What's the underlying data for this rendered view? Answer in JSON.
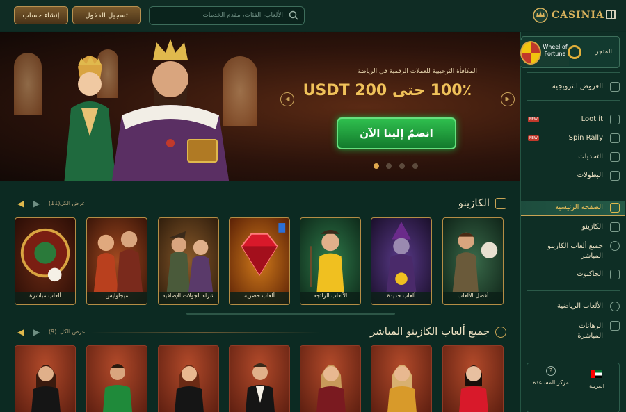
{
  "header": {
    "signup_label": "إنشاء حساب",
    "login_label": "تسجيل الدخول",
    "search_placeholder": "الألعاب، الفئات، مقدم الخدمات",
    "logo_text": "CASINIA"
  },
  "hero": {
    "subtitle": "المكافأة الترحيبية للعملات الرقمية في الرياضة",
    "title": "100٪ حتى 200 USDT",
    "cta_label": "انضمّ إلينا الآن",
    "slide_index": 1,
    "slide_count": 4
  },
  "casino_section": {
    "title": "الكازينو",
    "view_all": "عرض الكل",
    "count": "(11)",
    "games": [
      {
        "label": "ألعاب مباشرة"
      },
      {
        "label": "ميجاوايس"
      },
      {
        "label": "شراء الجولات الإضافية"
      },
      {
        "label": "ألعاب حصرية"
      },
      {
        "label": "الألعاب الرائجة"
      },
      {
        "label": "ألعاب جديدة"
      },
      {
        "label": "أفضل الألعاب"
      }
    ]
  },
  "live_section": {
    "title": "جميع ألعاب الكازينو المباشر",
    "view_all": "عرض الكل",
    "count": "(9)"
  },
  "sidebar": {
    "wheel_label": "Wheel of Fortune",
    "store_label": "المتجر",
    "promotions": "العروض الترويجية",
    "loot_it": "Loot it",
    "spin_rally": "Spin Rally",
    "new_badge": "NEW",
    "challenges": "التحديات",
    "tournaments": "البطولات",
    "home": "الصفحة الرئيسية",
    "casino": "الكازينو",
    "live_casino": "جميع ألعاب الكازينو المباشر",
    "jackpot": "الجاكبوت",
    "sports": "الألعاب الرياضية",
    "live_bets": "الرهانات المباشرة",
    "language": "العربية",
    "help": "مركز المساعدة"
  },
  "colors": {
    "background": "#0c2a22",
    "accent_gold": "#d8b25c",
    "cta_green": "#2fbf4e"
  }
}
